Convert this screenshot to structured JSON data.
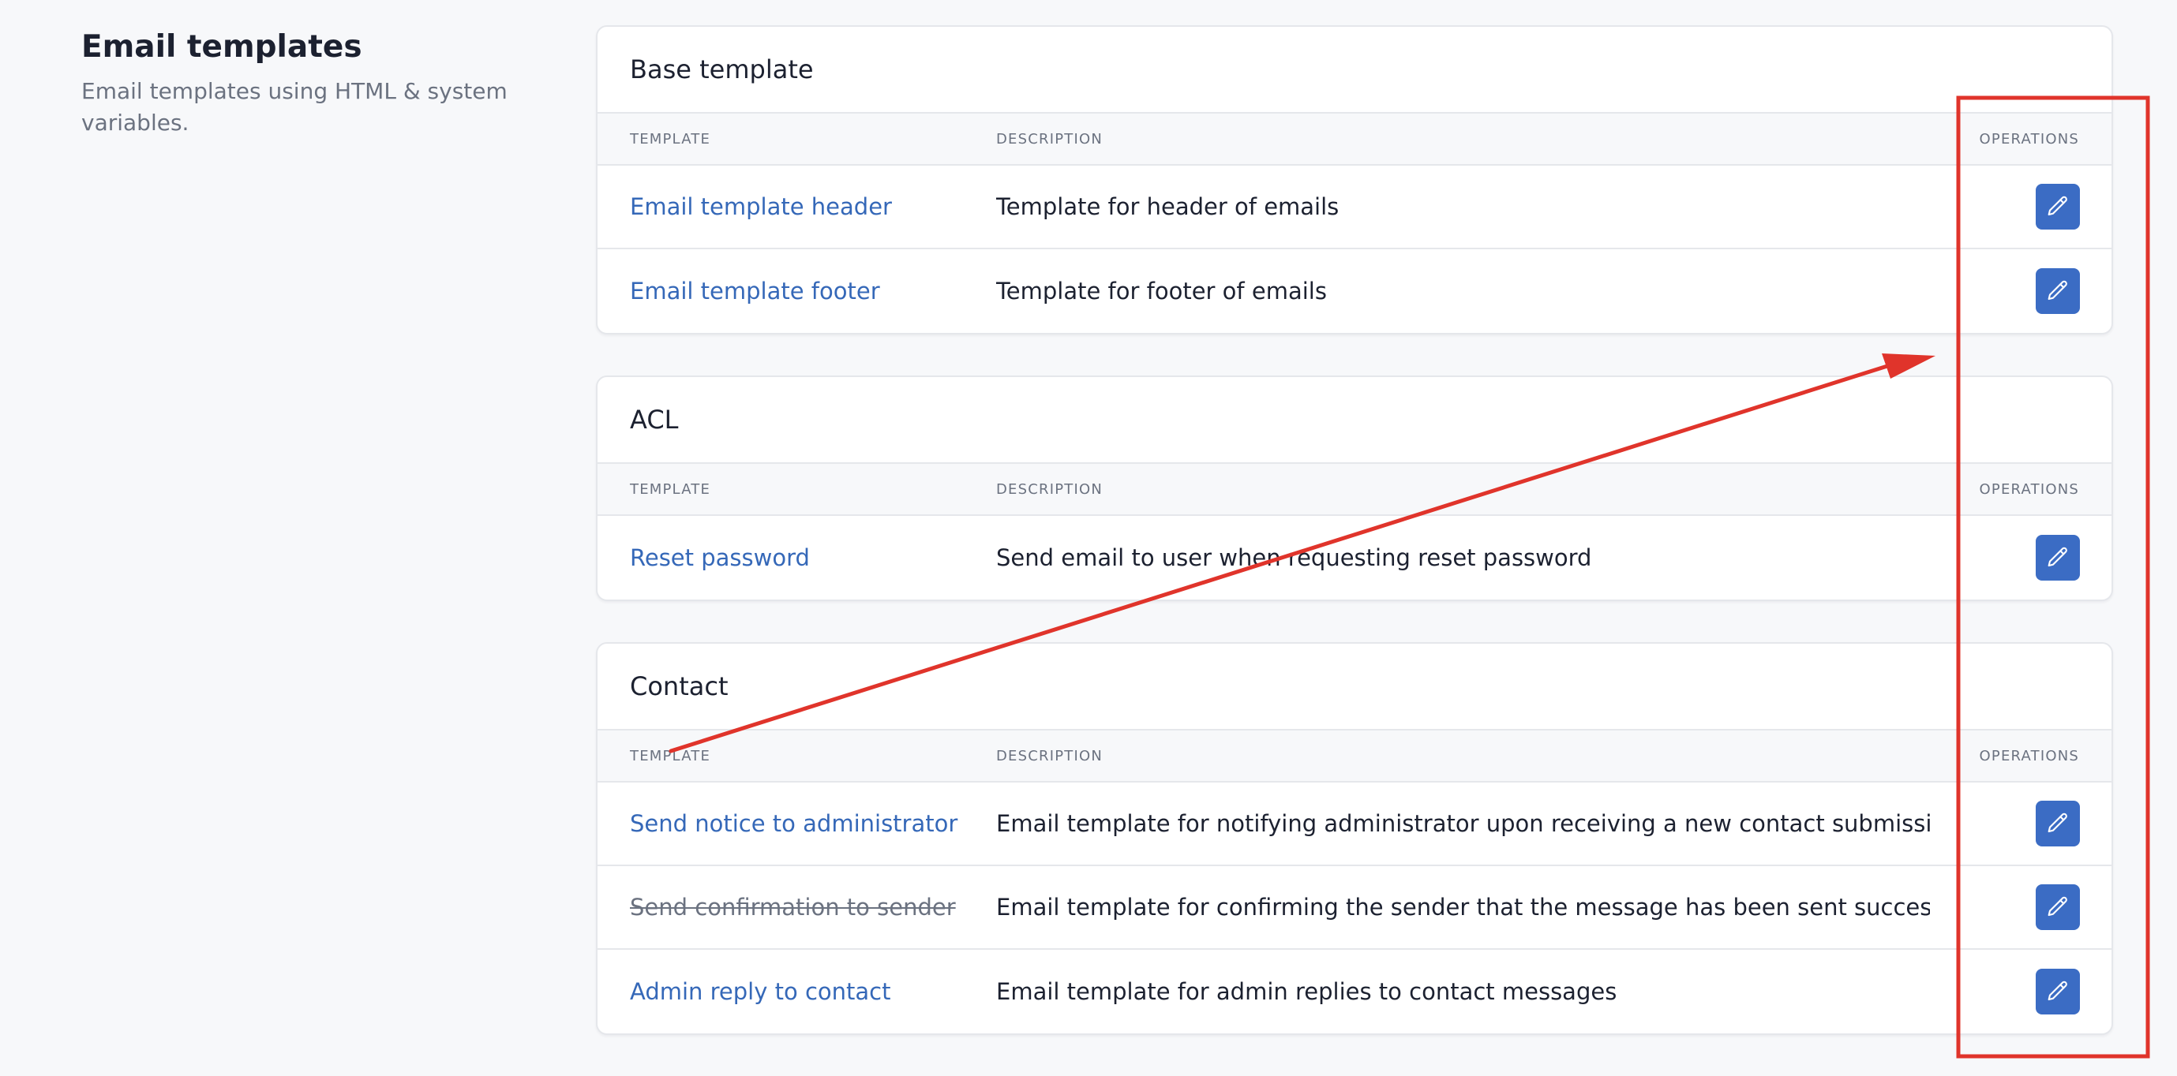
{
  "intro": {
    "title": "Email templates",
    "description": "Email templates using HTML & system variables."
  },
  "table_headers": {
    "template": "TEMPLATE",
    "description": "DESCRIPTION",
    "operations": "OPERATIONS"
  },
  "sections": [
    {
      "title": "Base template",
      "rows": [
        {
          "name": "Email template header",
          "description": "Template for header of emails",
          "disabled": false
        },
        {
          "name": "Email template footer",
          "description": "Template for footer of emails",
          "disabled": false
        }
      ]
    },
    {
      "title": "ACL",
      "rows": [
        {
          "name": "Reset password",
          "description": "Send email to user when requesting reset password",
          "disabled": false
        }
      ]
    },
    {
      "title": "Contact",
      "rows": [
        {
          "name": "Send notice to administrator",
          "description": "Email template for notifying administrator upon receiving a new contact submission",
          "disabled": false
        },
        {
          "name": "Send confirmation to sender",
          "description": "Email template for confirming the sender that the message has been sent successfully",
          "disabled": true
        },
        {
          "name": "Admin reply to contact",
          "description": "Email template for admin replies to contact messages",
          "disabled": false
        }
      ]
    }
  ],
  "icons": {
    "edit": "pencil-icon"
  },
  "colors": {
    "link": "#3568b8",
    "edit_button": "#3b6cc4",
    "annotation": "#e0342b"
  }
}
